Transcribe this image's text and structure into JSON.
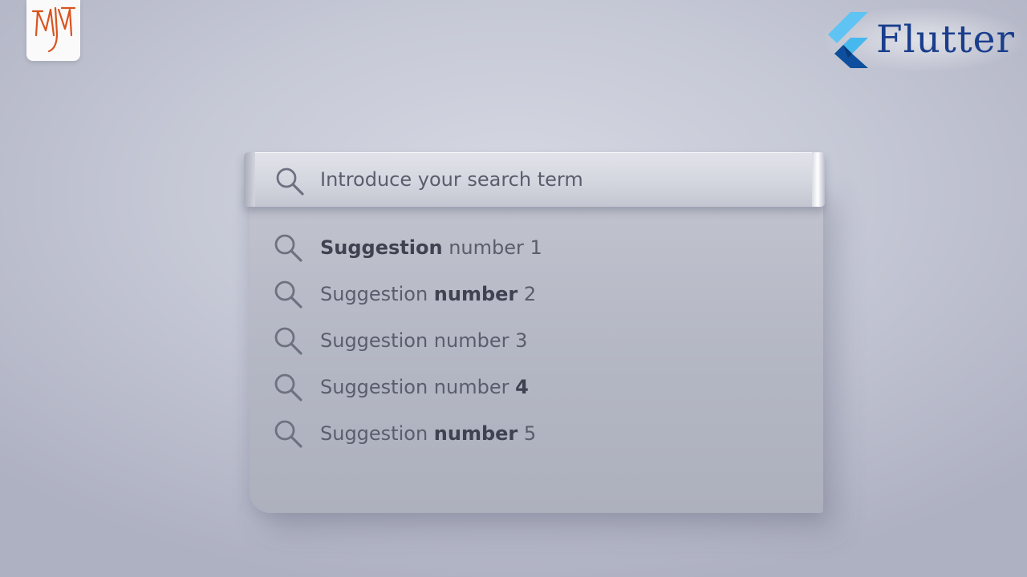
{
  "logo": {
    "icon": "mj-monogram-icon",
    "accent_color": "#d9541e"
  },
  "brand": {
    "icon": "flutter-logo-icon",
    "name": "Flutter",
    "color": "#1a3e8c"
  },
  "search": {
    "icon": "search-icon",
    "placeholder": "Introduce your search term",
    "value": ""
  },
  "suggestions": [
    {
      "icon": "search-icon",
      "parts": [
        {
          "text": "Suggestion",
          "bold": true
        },
        {
          "text": " number 1",
          "bold": false
        }
      ]
    },
    {
      "icon": "search-icon",
      "parts": [
        {
          "text": "Suggestion ",
          "bold": false
        },
        {
          "text": "number",
          "bold": true
        },
        {
          "text": " 2",
          "bold": false
        }
      ]
    },
    {
      "icon": "search-icon",
      "parts": [
        {
          "text": "Suggestion number 3",
          "bold": false
        }
      ]
    },
    {
      "icon": "search-icon",
      "parts": [
        {
          "text": "Suggestion number ",
          "bold": false
        },
        {
          "text": "4",
          "bold": true
        }
      ]
    },
    {
      "icon": "search-icon",
      "parts": [
        {
          "text": "Suggestion ",
          "bold": false
        },
        {
          "text": "number",
          "bold": true
        },
        {
          "text": " 5",
          "bold": false
        }
      ]
    }
  ],
  "colors": {
    "text": "#5a5d6c",
    "text_bold": "#3f4250",
    "icon": "#6e7180"
  }
}
